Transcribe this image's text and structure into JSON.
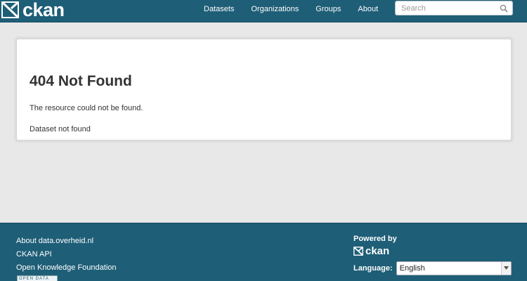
{
  "header": {
    "logo_text": "ckan",
    "nav": [
      "Datasets",
      "Organizations",
      "Groups",
      "About"
    ],
    "search_placeholder": "Search"
  },
  "main": {
    "title": "404 Not Found",
    "message": "The resource could not be found.",
    "detail": "Dataset not found"
  },
  "footer": {
    "links": [
      "About data.overheid.nl",
      "CKAN API",
      "Open Knowledge Foundation"
    ],
    "badge": "OPEN DATA",
    "powered_by": "Powered by",
    "powered_logo_text": "ckan",
    "language_label": "Language:",
    "language_value": "English"
  },
  "colors": {
    "brand": "#1e5e77",
    "page_bg": "#e8e8e8"
  }
}
